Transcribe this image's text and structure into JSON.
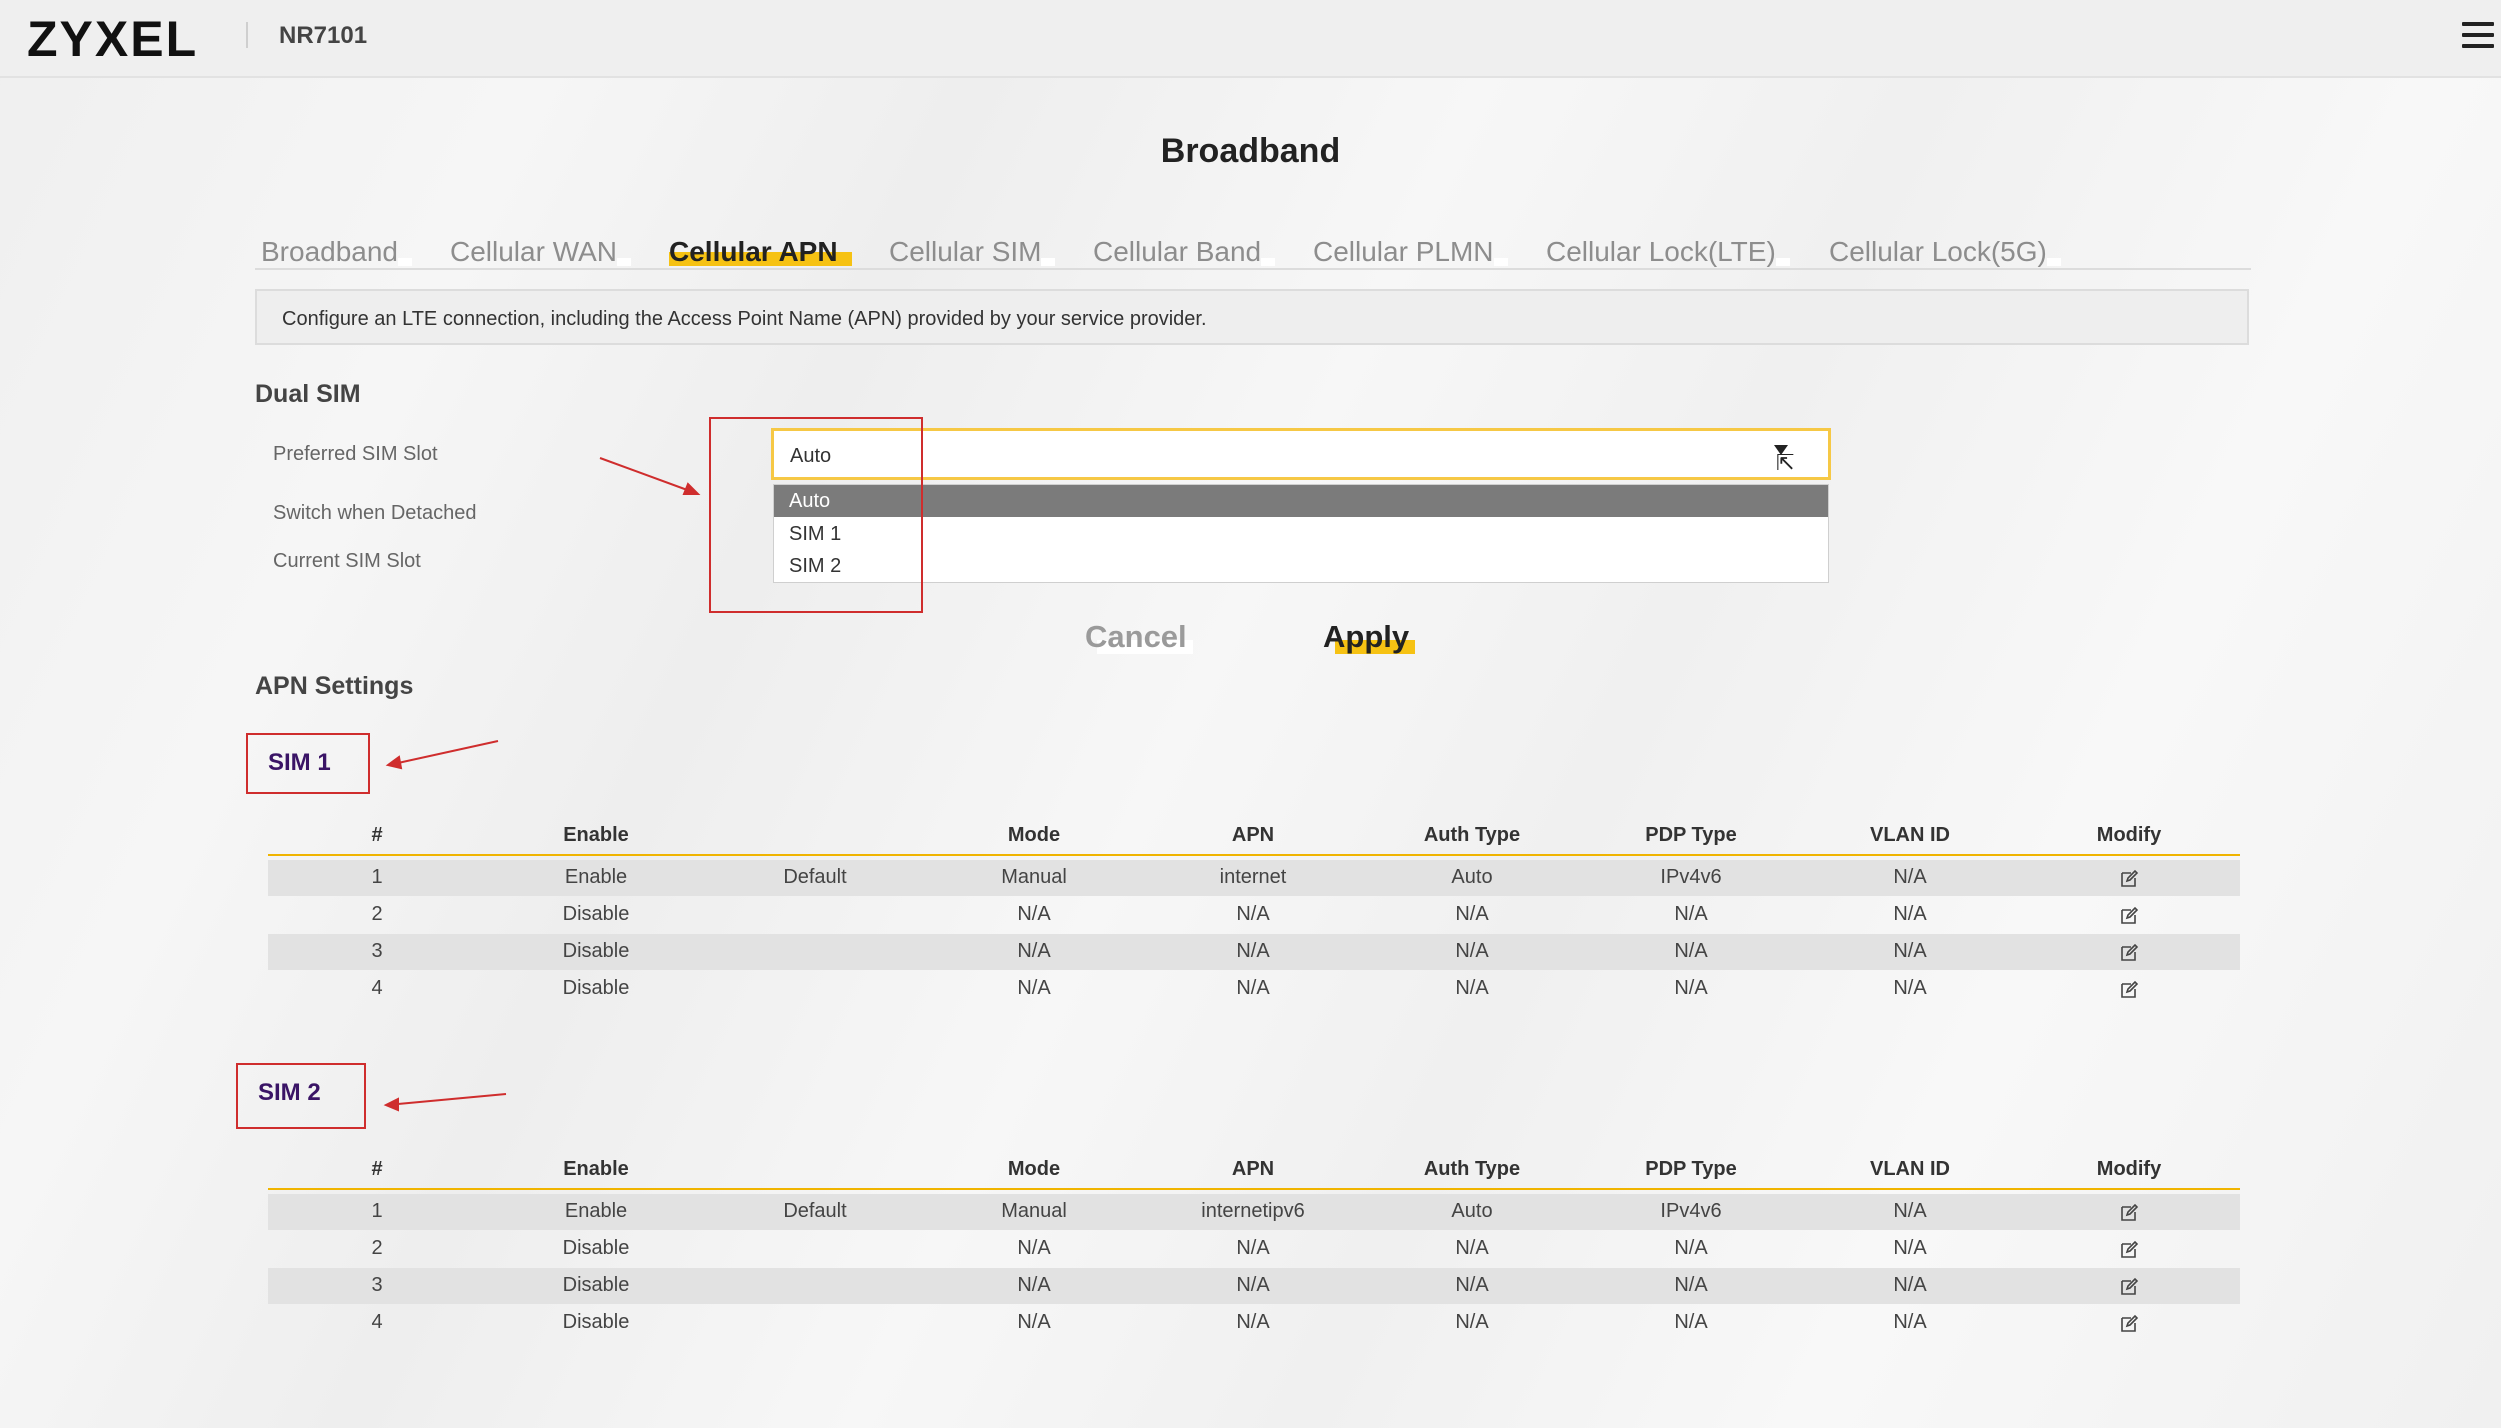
{
  "header": {
    "logo_text": "ZYXEL",
    "model": "NR7101",
    "menu_icon": "hamburger-menu-icon"
  },
  "page": {
    "title": "Broadband",
    "description": "Configure an LTE connection, including the Access Point Name (APN) provided by your service provider."
  },
  "tabs": [
    {
      "label": "Broadband",
      "active": false
    },
    {
      "label": "Cellular WAN",
      "active": false
    },
    {
      "label": "Cellular APN",
      "active": true
    },
    {
      "label": "Cellular SIM",
      "active": false
    },
    {
      "label": "Cellular Band",
      "active": false
    },
    {
      "label": "Cellular PLMN",
      "active": false
    },
    {
      "label": "Cellular Lock(LTE)",
      "active": false
    },
    {
      "label": "Cellular Lock(5G)",
      "active": false
    }
  ],
  "dual_sim": {
    "title": "Dual SIM",
    "preferred_label": "Preferred SIM Slot",
    "switch_label": "Switch when Detached",
    "current_label": "Current SIM Slot",
    "preferred_value": "Auto",
    "options": [
      "Auto",
      "SIM 1",
      "SIM 2"
    ],
    "selected_option": "Auto"
  },
  "buttons": {
    "cancel": "Cancel",
    "apply": "Apply"
  },
  "apn_settings": {
    "title": "APN Settings",
    "columns": [
      "#",
      "Enable",
      "Mode",
      "APN",
      "Auth Type",
      "PDP Type",
      "VLAN ID",
      "Modify"
    ],
    "sims": [
      {
        "label": "SIM 1",
        "rows": [
          {
            "num": "1",
            "enable": "Enable",
            "default": "Default",
            "mode": "Manual",
            "apn": "internet",
            "auth": "Auto",
            "pdp": "IPv4v6",
            "vlan": "N/A"
          },
          {
            "num": "2",
            "enable": "Disable",
            "default": "",
            "mode": "N/A",
            "apn": "N/A",
            "auth": "N/A",
            "pdp": "N/A",
            "vlan": "N/A"
          },
          {
            "num": "3",
            "enable": "Disable",
            "default": "",
            "mode": "N/A",
            "apn": "N/A",
            "auth": "N/A",
            "pdp": "N/A",
            "vlan": "N/A"
          },
          {
            "num": "4",
            "enable": "Disable",
            "default": "",
            "mode": "N/A",
            "apn": "N/A",
            "auth": "N/A",
            "pdp": "N/A",
            "vlan": "N/A"
          }
        ]
      },
      {
        "label": "SIM 2",
        "rows": [
          {
            "num": "1",
            "enable": "Enable",
            "default": "Default",
            "mode": "Manual",
            "apn": "internetipv6",
            "auth": "Auto",
            "pdp": "IPv4v6",
            "vlan": "N/A"
          },
          {
            "num": "2",
            "enable": "Disable",
            "default": "",
            "mode": "N/A",
            "apn": "N/A",
            "auth": "N/A",
            "pdp": "N/A",
            "vlan": "N/A"
          },
          {
            "num": "3",
            "enable": "Disable",
            "default": "",
            "mode": "N/A",
            "apn": "N/A",
            "auth": "N/A",
            "pdp": "N/A",
            "vlan": "N/A"
          },
          {
            "num": "4",
            "enable": "Disable",
            "default": "",
            "mode": "N/A",
            "apn": "N/A",
            "auth": "N/A",
            "pdp": "N/A",
            "vlan": "N/A"
          }
        ]
      }
    ]
  },
  "colors": {
    "accent": "#f6c213",
    "annotation": "#cf2d2d",
    "sim_label": "#3a1466"
  }
}
